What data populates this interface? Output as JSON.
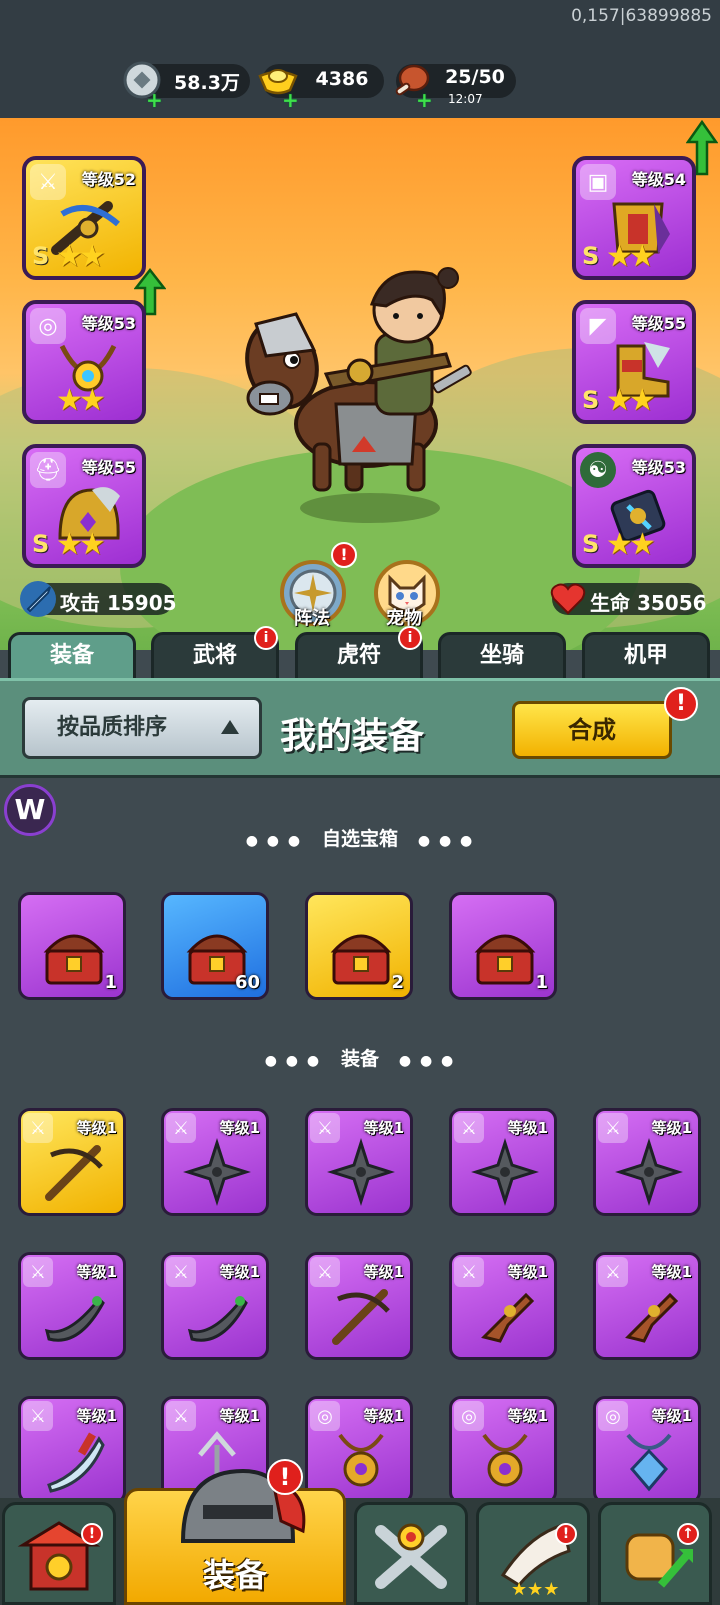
{
  "debug_text": "0,157|63899885",
  "resources": {
    "silver": {
      "value": "58.3万",
      "icon": "silver-coin-icon"
    },
    "gold": {
      "value": "4386",
      "icon": "gold-ingot-icon"
    },
    "stamina": {
      "value": "25/50",
      "timer": "12:07",
      "icon": "meat-icon"
    }
  },
  "equipment_slots_left": [
    {
      "level": "等级52",
      "rank": "S",
      "stars": "★★",
      "quality": "gold",
      "type_icon": "sword-icon",
      "item_icon": "crossbow-icon"
    },
    {
      "level": "等级53",
      "rank": "",
      "stars": "★★",
      "quality": "purple",
      "type_icon": "medal-icon",
      "item_icon": "necklace-icon"
    },
    {
      "level": "等级55",
      "rank": "S",
      "stars": "★★",
      "quality": "purple",
      "type_icon": "helmet-icon",
      "item_icon": "helmet-icon"
    }
  ],
  "equipment_slots_right": [
    {
      "level": "等级54",
      "rank": "S",
      "stars": "★★",
      "quality": "purple",
      "type_icon": "armor-icon",
      "item_icon": "armor-icon"
    },
    {
      "level": "等级55",
      "rank": "S",
      "stars": "★★",
      "quality": "purple",
      "type_icon": "boot-icon",
      "item_icon": "boot-icon"
    },
    {
      "level": "等级53",
      "rank": "S",
      "stars": "★★",
      "quality": "purple",
      "type_icon": "yinyang-icon",
      "item_icon": "talisman-icon"
    }
  ],
  "stats": {
    "attack": "攻击 15905",
    "health": "生命 35056"
  },
  "hero_buttons": {
    "formation": "阵法",
    "pet": "宠物"
  },
  "tabs": [
    "装备",
    "武将",
    "虎符",
    "坐骑",
    "机甲"
  ],
  "panel": {
    "sort_label": "按品质排序",
    "title": "我的装备",
    "compose_label": "合成",
    "badge": "!"
  },
  "sections": {
    "chests": "自选宝箱",
    "equipment": "装备"
  },
  "chests": [
    {
      "count": "1",
      "quality": "purple",
      "icon": "mystery-chest-icon"
    },
    {
      "count": "60",
      "quality": "blue",
      "icon": "mystery-chest-icon"
    },
    {
      "count": "2",
      "quality": "gold",
      "icon": "panda-chest-icon"
    },
    {
      "count": "1",
      "quality": "purple",
      "icon": "hero-chest-icon"
    }
  ],
  "equipment_items": [
    {
      "level": "等级1",
      "quality": "gold",
      "type_icon": "sword-icon",
      "icon": "crossbow-icon"
    },
    {
      "level": "等级1",
      "quality": "purple",
      "type_icon": "sword-icon",
      "icon": "shuriken-icon"
    },
    {
      "level": "等级1",
      "quality": "purple",
      "type_icon": "sword-icon",
      "icon": "shuriken-icon"
    },
    {
      "level": "等级1",
      "quality": "purple",
      "type_icon": "sword-icon",
      "icon": "shuriken-icon"
    },
    {
      "level": "等级1",
      "quality": "purple",
      "type_icon": "sword-icon",
      "icon": "shuriken-icon"
    },
    {
      "level": "等级1",
      "quality": "purple",
      "type_icon": "sword-icon",
      "icon": "scimitar-icon"
    },
    {
      "level": "等级1",
      "quality": "purple",
      "type_icon": "sword-icon",
      "icon": "scimitar-icon"
    },
    {
      "level": "等级1",
      "quality": "purple",
      "type_icon": "sword-icon",
      "icon": "crossbow-icon"
    },
    {
      "level": "等级1",
      "quality": "purple",
      "type_icon": "sword-icon",
      "icon": "pistol-icon"
    },
    {
      "level": "等级1",
      "quality": "purple",
      "type_icon": "sword-icon",
      "icon": "pistol-icon"
    },
    {
      "level": "等级1",
      "quality": "purple",
      "type_icon": "sword-icon",
      "icon": "glaive-icon"
    },
    {
      "level": "等级1",
      "quality": "purple",
      "type_icon": "sword-icon",
      "icon": "trident-icon"
    },
    {
      "level": "等级1",
      "quality": "purple",
      "type_icon": "medal-icon",
      "icon": "amulet-icon"
    },
    {
      "level": "等级1",
      "quality": "purple",
      "type_icon": "medal-icon",
      "icon": "amulet-icon"
    },
    {
      "level": "等级1",
      "quality": "purple",
      "type_icon": "medal-icon",
      "icon": "crystal-amulet-icon"
    }
  ],
  "bottom_nav": {
    "equip_label": "装备"
  },
  "colors": {
    "purple": "#b24ee6",
    "gold": "#f7c51c",
    "blue": "#3a93f2",
    "badge_red": "#e0201c",
    "accent_green": "#5b8f7c"
  }
}
